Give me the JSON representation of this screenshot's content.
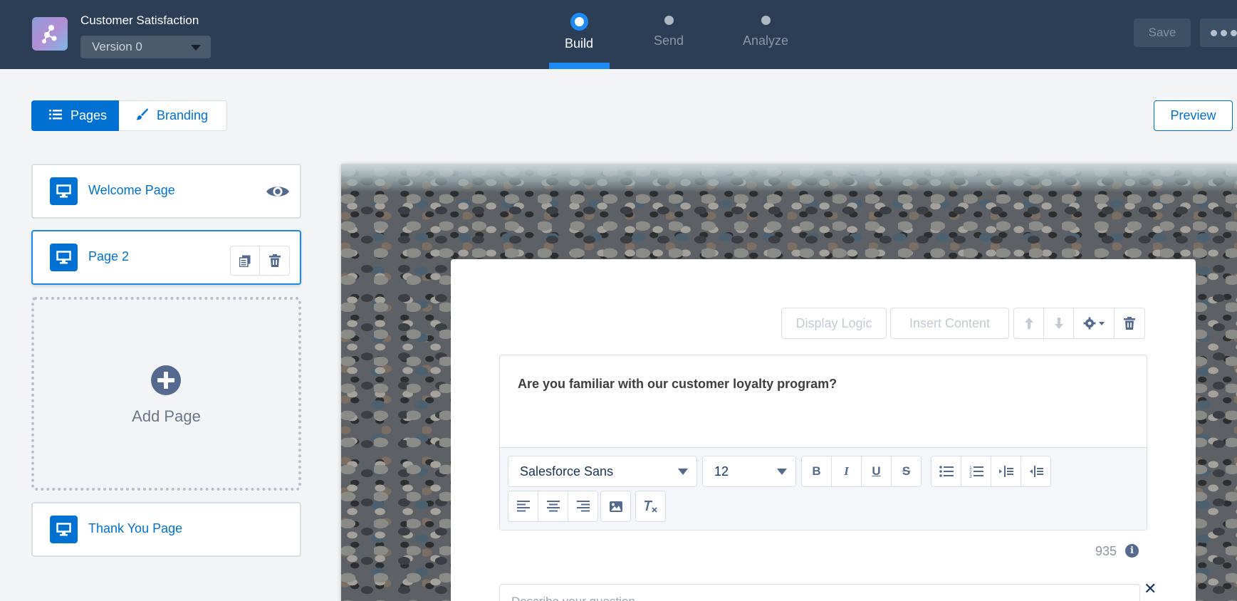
{
  "header": {
    "survey_title": "Customer Satisfaction",
    "version": "Version 0",
    "steps": [
      {
        "label": "Build",
        "active": true
      },
      {
        "label": "Send",
        "active": false
      },
      {
        "label": "Analyze",
        "active": false
      }
    ],
    "save_label": "Save",
    "accent_color": "#1b8af5",
    "background_color": "#2b3e55"
  },
  "toolbar": {
    "pages_label": "Pages",
    "branding_label": "Branding",
    "preview_label": "Preview"
  },
  "pages": {
    "items": [
      {
        "label": "Welcome Page"
      },
      {
        "label": "Page 2"
      },
      {
        "label": "Thank You Page"
      }
    ],
    "add_page_label": "Add Page"
  },
  "question": {
    "display_logic_label": "Display Logic",
    "insert_content_label": "Insert Content",
    "text": "Are you familiar with our customer loyalty program?",
    "font_family": "Salesforce Sans",
    "font_size": "12",
    "char_count": "935",
    "description_placeholder": "Describe your question"
  }
}
